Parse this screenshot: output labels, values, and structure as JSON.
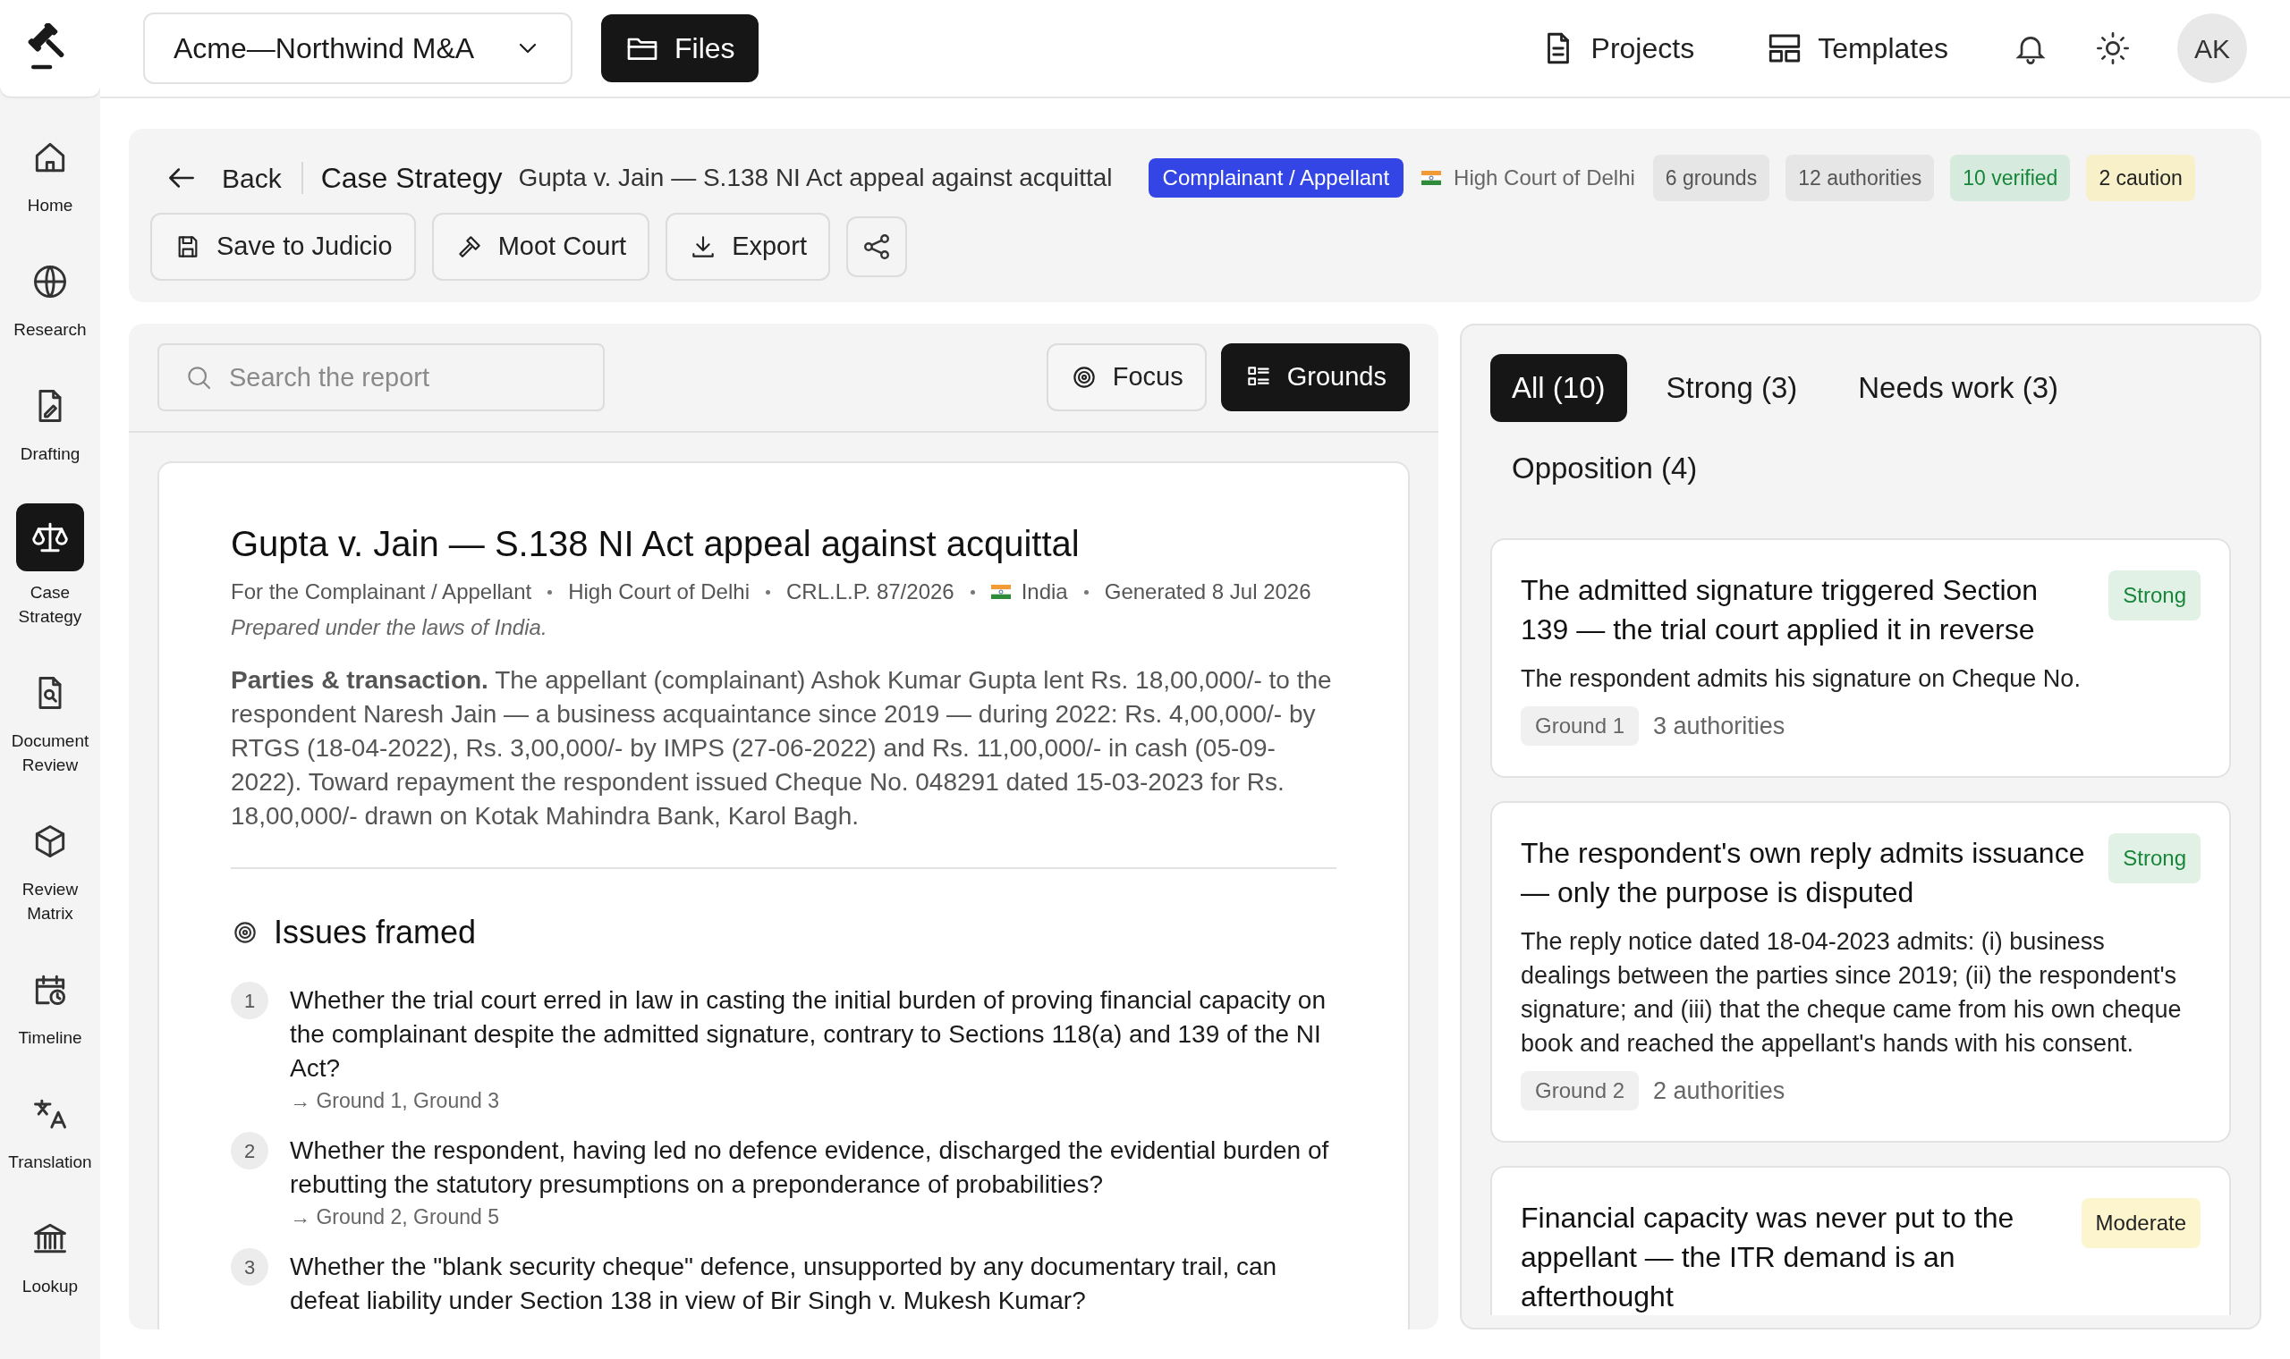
{
  "workspace": {
    "project": "Acme—Northwind M&A",
    "files_button": "Files"
  },
  "top_nav": [
    {
      "label": "Projects"
    },
    {
      "label": "Templates"
    }
  ],
  "avatar": "AK",
  "sidebar": {
    "items": [
      {
        "label": "Home",
        "selected": false
      },
      {
        "label": "Research",
        "selected": false
      },
      {
        "label": "Drafting",
        "selected": false
      },
      {
        "label": "Case Strategy",
        "selected": true
      },
      {
        "label": "Document Review",
        "selected": false
      },
      {
        "label": "Review Matrix",
        "selected": false
      },
      {
        "label": "Timeline",
        "selected": false
      },
      {
        "label": "Translation",
        "selected": false
      },
      {
        "label": "Lookup",
        "selected": false
      }
    ]
  },
  "header": {
    "back": "Back",
    "title": "Case Strategy",
    "subtitle": "Gupta v. Jain — S.138 NI Act appeal against acquittal",
    "role_badge": "Complainant / Appellant",
    "court": "High Court of Delhi",
    "chips": [
      {
        "label": "6 grounds",
        "kind": "neutral"
      },
      {
        "label": "12 authorities",
        "kind": "neutral"
      },
      {
        "label": "10 verified",
        "kind": "verified"
      },
      {
        "label": "2 caution",
        "kind": "caution"
      }
    ],
    "actions": [
      "Save to Judicio",
      "Moot Court",
      "Export"
    ]
  },
  "report_toolbar": {
    "search": {
      "placeholder": "Search the report"
    },
    "buttons": [
      {
        "label": "Focus",
        "selected": false
      },
      {
        "label": "Grounds",
        "selected": true
      }
    ]
  },
  "report": {
    "title": "Gupta v. Jain — S.138 NI Act appeal against acquittal",
    "meta": [
      {
        "text": "For the Complainant / Appellant",
        "kind": "text"
      },
      {
        "text": "High Court of Delhi",
        "kind": "text"
      },
      {
        "text": "CRL.L.P. 87/2026",
        "kind": "text"
      },
      {
        "text": "India",
        "kind": "country"
      },
      {
        "text": "Generated 8 Jul 2026",
        "kind": "text"
      }
    ],
    "note": "Prepared under the laws of India.",
    "summary": "**Parties & transaction.** The appellant (complainant) Ashok Kumar Gupta lent Rs. 18,00,000/- to the respondent Naresh Jain — a business acquaintance since 2019 — during 2022: Rs. 4,00,000/- by RTGS (18-04-2022), Rs. 3,00,000/- by IMPS (27-06-2022) and Rs. 11,00,000/- in cash (05-09-2022). Toward repayment the respondent issued Cheque No. 048291 dated 15-03-2023 for Rs. 18,00,000/- drawn on Kotak Mahindra Bank, Karol Bagh.",
    "issues_heading": "Issues framed",
    "issues": [
      {
        "number": "1",
        "text": "Whether the trial court erred in law in casting the initial burden of proving financial capacity on the complainant despite the admitted signature, contrary to Sections 118(a) and 139 of the NI Act?",
        "grounds": "→ Ground 1, Ground 3"
      },
      {
        "number": "2",
        "text": "Whether the respondent, having led no defence evidence, discharged the evidential burden of rebutting the statutory presumptions on a preponderance of probabilities?",
        "grounds": "→ Ground 2, Ground 5"
      },
      {
        "number": "3",
        "text": "Whether the \"blank security cheque\" defence, unsupported by any documentary trail, can defeat liability under Section 138 in view of Bir Singh v. Mukesh Kumar?"
      }
    ]
  },
  "grounds_panel": {
    "tabs": [
      {
        "label": "All (10)",
        "selected": true
      },
      {
        "label": "Strong (3)",
        "selected": false
      },
      {
        "label": "Needs work (3)",
        "selected": false
      },
      {
        "label": "Opposition (4)",
        "selected": false
      }
    ],
    "cards": [
      {
        "title": "The admitted signature triggered Section 139 — the trial court applied it in reverse",
        "strength": {
          "label": "Strong",
          "kind": "strong"
        },
        "body": "The respondent admits his signature on Cheque No.",
        "ground": "Ground 1",
        "authorities": "3 authorities"
      },
      {
        "title": "The respondent's own reply admits issuance — only the purpose is disputed",
        "strength": {
          "label": "Strong",
          "kind": "strong"
        },
        "body": "The reply notice dated 18-04-2023 admits: (i) business dealings between the parties since 2019; (ii) the respondent's signature; and (iii) that the cheque came from his own cheque book and reached the appellant's hands with his consent.",
        "ground": "Ground 2",
        "authorities": "2 authorities"
      },
      {
        "title": "Financial capacity was never put to the appellant — the ITR demand is an afterthought",
        "strength": {
          "label": "Moderate",
          "kind": "moderate"
        }
      }
    ]
  }
}
